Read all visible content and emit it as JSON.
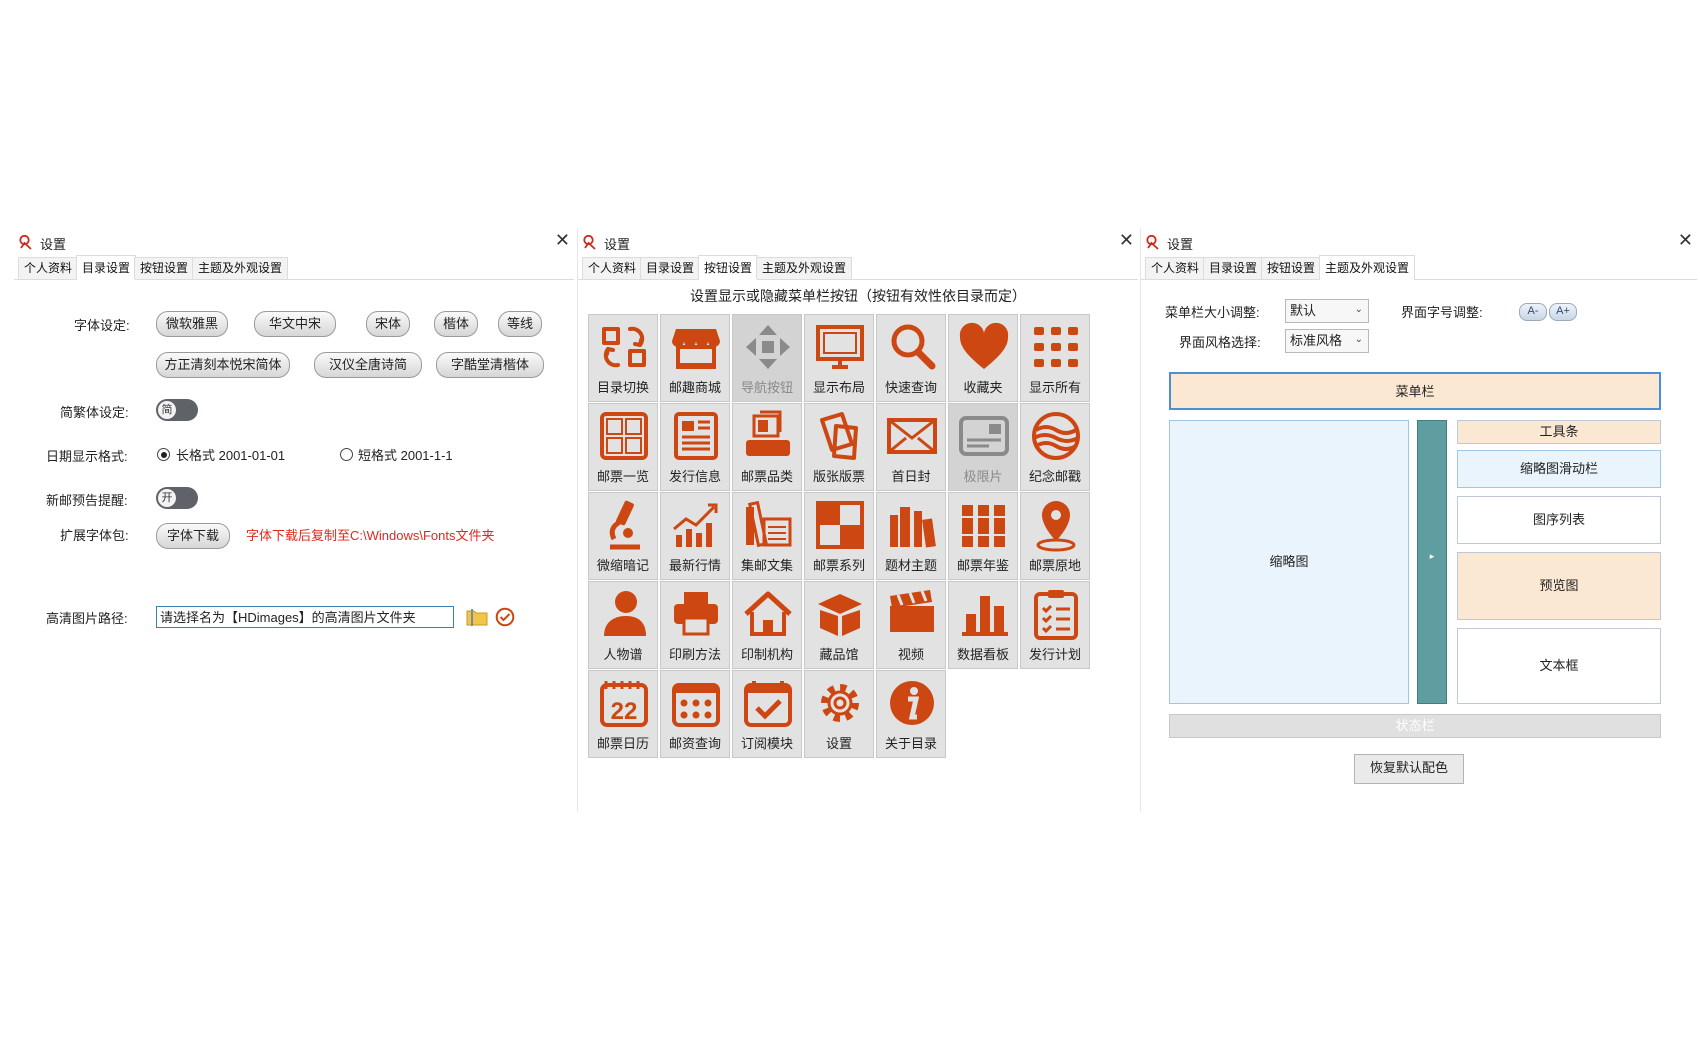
{
  "windows": [
    {
      "title": "设置",
      "tabs": [
        "个人资料",
        "目录设置",
        "按钮设置",
        "主题及外观设置"
      ],
      "active_tab": 1
    },
    {
      "title": "设置",
      "tabs": [
        "个人资料",
        "目录设置",
        "按钮设置",
        "主题及外观设置"
      ],
      "active_tab": 2
    },
    {
      "title": "设置",
      "tabs": [
        "个人资料",
        "目录设置",
        "按钮设置",
        "主题及外观设置"
      ],
      "active_tab": 3
    }
  ],
  "colors": {
    "accent": "#cc4711",
    "icon_disabled": "#8a8a8a",
    "note_red": "#e0281e",
    "menu_bar": "#fbe8d3",
    "thumb_bg": "#eaf4fc",
    "slider_teal": "#5e9ea0"
  },
  "directory": {
    "font_label": "字体设定:",
    "fonts_row1": [
      "微软雅黑",
      "华文中宋",
      "宋体",
      "楷体",
      "等线"
    ],
    "fonts_row2": [
      "方正清刻本悦宋简体",
      "汉仪全唐诗简",
      "字酷堂清楷体"
    ],
    "trad_label": "简繁体设定:",
    "trad_toggle": "简",
    "date_label": "日期显示格式:",
    "date_long": "长格式 2001-01-01",
    "date_short": "短格式 2001-1-1",
    "date_selected": "long",
    "alert_label": "新邮预告提醒:",
    "alert_toggle": "开",
    "ext_font_label": "扩展字体包:",
    "font_download": "字体下载",
    "font_note": "字体下载后复制至C:\\Windows\\Fonts文件夹",
    "hd_label": "高清图片路径:",
    "hd_placeholder": "请选择名为【HDimages】的高清图片文件夹"
  },
  "buttons": {
    "title": "设置显示或隐藏菜单栏按钮（按钮有效性依目录而定）",
    "items": [
      {
        "label": "目录切换",
        "icon": "switch-icon",
        "enabled": true
      },
      {
        "label": "邮趣商城",
        "icon": "shop-icon",
        "enabled": true
      },
      {
        "label": "导航按钮",
        "icon": "navigation-icon",
        "enabled": false
      },
      {
        "label": "显示布局",
        "icon": "monitor-icon",
        "enabled": true
      },
      {
        "label": "快速查询",
        "icon": "search-icon",
        "enabled": true
      },
      {
        "label": "收藏夹",
        "icon": "heart-icon",
        "enabled": true
      },
      {
        "label": "显示所有",
        "icon": "grid-icon",
        "enabled": true
      },
      {
        "label": "邮票一览",
        "icon": "gallery-icon",
        "enabled": true
      },
      {
        "label": "发行信息",
        "icon": "newspaper-icon",
        "enabled": true
      },
      {
        "label": "邮票品类",
        "icon": "stamp-category-icon",
        "enabled": true
      },
      {
        "label": "版张版票",
        "icon": "sheets-icon",
        "enabled": true
      },
      {
        "label": "首日封",
        "icon": "envelope-icon",
        "enabled": true
      },
      {
        "label": "极限片",
        "icon": "postcard-icon",
        "enabled": false
      },
      {
        "label": "纪念邮戳",
        "icon": "postmark-icon",
        "enabled": true
      },
      {
        "label": "微缩暗记",
        "icon": "microscope-icon",
        "enabled": true
      },
      {
        "label": "最新行情",
        "icon": "trend-icon",
        "enabled": true
      },
      {
        "label": "集邮文集",
        "icon": "books-icon",
        "enabled": true
      },
      {
        "label": "邮票系列",
        "icon": "checker-icon",
        "enabled": true
      },
      {
        "label": "题材主题",
        "icon": "library-icon",
        "enabled": true
      },
      {
        "label": "邮票年鉴",
        "icon": "yearbook-icon",
        "enabled": true
      },
      {
        "label": "邮票原地",
        "icon": "location-icon",
        "enabled": true
      },
      {
        "label": "人物谱",
        "icon": "person-icon",
        "enabled": true
      },
      {
        "label": "印刷方法",
        "icon": "printer-icon",
        "enabled": true
      },
      {
        "label": "印制机构",
        "icon": "home-icon",
        "enabled": true
      },
      {
        "label": "藏品馆",
        "icon": "box-icon",
        "enabled": true
      },
      {
        "label": "视频",
        "icon": "video-icon",
        "enabled": true
      },
      {
        "label": "数据看板",
        "icon": "bar-chart-icon",
        "enabled": true
      },
      {
        "label": "发行计划",
        "icon": "clipboard-icon",
        "enabled": true
      },
      {
        "label": "邮票日历",
        "icon": "calendar-22-icon",
        "enabled": true,
        "number": "22"
      },
      {
        "label": "邮资查询",
        "icon": "calendar-grid-icon",
        "enabled": true
      },
      {
        "label": "订阅模块",
        "icon": "calendar-check-icon",
        "enabled": true
      },
      {
        "label": "设置",
        "icon": "gear-icon",
        "enabled": true
      },
      {
        "label": "关于目录",
        "icon": "info-icon",
        "enabled": true
      }
    ]
  },
  "theme": {
    "menu_size_label": "菜单栏大小调整:",
    "menu_size_value": "默认",
    "font_size_label": "界面字号调整:",
    "font_minus": "A-",
    "font_plus": "A+",
    "style_label": "界面风格选择:",
    "style_value": "标准风格",
    "preview": {
      "menu_bar": "菜单栏",
      "thumbnail": "缩略图",
      "toolbar": "工具条",
      "thumb_slider": "缩略图滑动栏",
      "sequence_list": "图序列表",
      "preview_pane": "预览图",
      "text_box": "文本框",
      "status_bar": "状态栏"
    },
    "restore": "恢复默认配色"
  }
}
